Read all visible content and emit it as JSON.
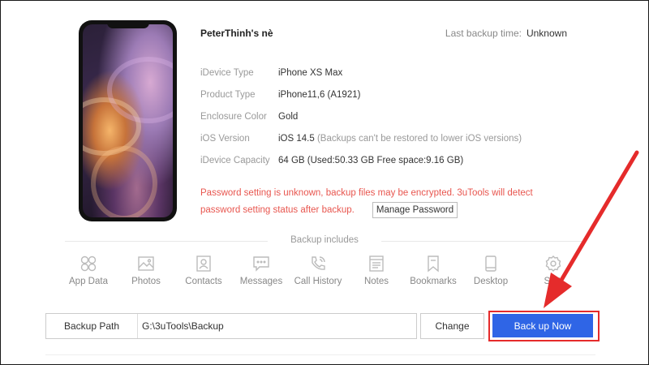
{
  "device": {
    "name": "PeterThinh's nè",
    "last_backup_label": "Last backup time:",
    "last_backup_value": "Unknown",
    "info": [
      {
        "label": "iDevice Type",
        "value": "iPhone XS Max",
        "note": ""
      },
      {
        "label": "Product Type",
        "value": "iPhone11,6 (A1921)",
        "note": ""
      },
      {
        "label": "Enclosure Color",
        "value": "Gold",
        "note": ""
      },
      {
        "label": "iOS Version",
        "value": "iOS 14.5",
        "note": "(Backups can't be restored to lower iOS versions)"
      },
      {
        "label": "iDevice Capacity",
        "value": "64 GB (Used:50.33 GB  Free space:9.16 GB)",
        "note": ""
      }
    ],
    "warning_line1": "Password setting is unknown, backup files may be encrypted. 3uTools will detect",
    "warning_line2": "password setting status after backup.",
    "manage_password_label": "Manage Password"
  },
  "backup_includes": {
    "title": "Backup includes",
    "items": [
      {
        "label": "App Data",
        "icon": "app-data-icon"
      },
      {
        "label": "Photos",
        "icon": "photos-icon"
      },
      {
        "label": "Contacts",
        "icon": "contacts-icon"
      },
      {
        "label": "Messages",
        "icon": "messages-icon"
      },
      {
        "label": "Call History",
        "icon": "call-history-icon"
      },
      {
        "label": "Notes",
        "icon": "notes-icon"
      },
      {
        "label": "Bookmarks",
        "icon": "bookmarks-icon"
      },
      {
        "label": "Desktop",
        "icon": "desktop-icon"
      },
      {
        "label": "Setti",
        "icon": "settings-icon"
      }
    ]
  },
  "backup_path": {
    "label": "Backup Path",
    "value": "G:\\3uTools\\Backup",
    "change_label": "Change",
    "backup_now_label": "Back up Now"
  },
  "colors": {
    "accent": "#2f65e6",
    "warning": "#e8564f",
    "highlight": "#e52b2b"
  }
}
